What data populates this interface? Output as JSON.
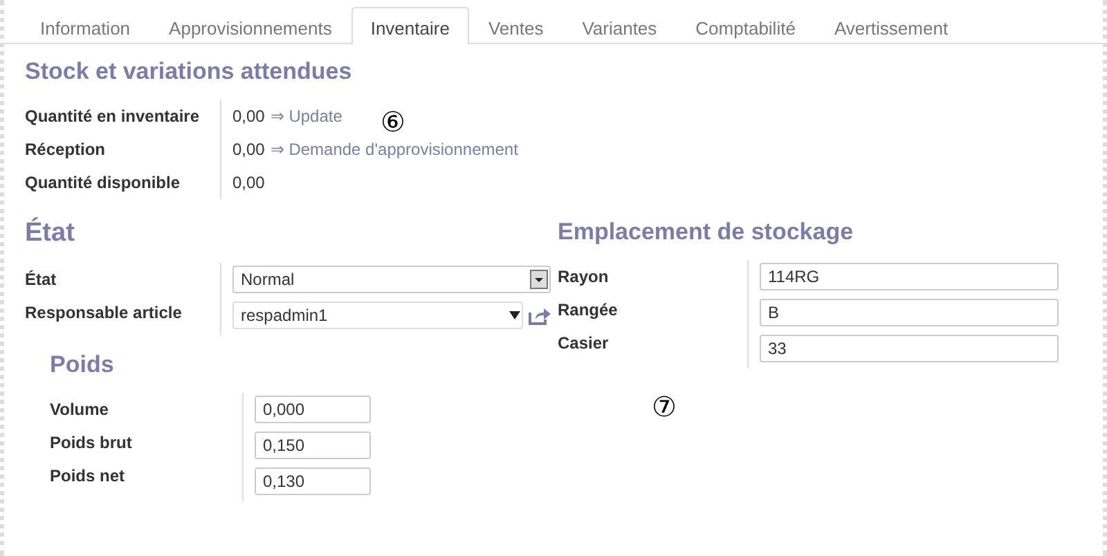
{
  "tabs": [
    {
      "label": "Information",
      "selected": false
    },
    {
      "label": "Approvisionnements",
      "selected": false
    },
    {
      "label": "Inventaire",
      "selected": true
    },
    {
      "label": "Ventes",
      "selected": false
    },
    {
      "label": "Variantes",
      "selected": false
    },
    {
      "label": "Comptabilité",
      "selected": false
    },
    {
      "label": "Avertissement",
      "selected": false
    }
  ],
  "stock": {
    "title": "Stock et variations attendues",
    "rows": [
      {
        "label": "Quantité en inventaire",
        "value": "0,00",
        "link": "⇒ Update"
      },
      {
        "label": "Réception",
        "value": "0,00",
        "link": "⇒ Demande d'approvisionnement"
      },
      {
        "label": "Quantité disponible",
        "value": "0,00"
      }
    ]
  },
  "etat": {
    "title": "État",
    "rows": [
      {
        "label": "État",
        "kind": "select",
        "value": "Normal"
      },
      {
        "label": "Responsable article",
        "kind": "many2one",
        "value": "respadmin1"
      }
    ]
  },
  "emplacement": {
    "title": "Emplacement de stockage",
    "rows": [
      {
        "label": "Rayon",
        "value": "114RG"
      },
      {
        "label": "Rangée",
        "value": "B"
      },
      {
        "label": "Casier",
        "value": "33"
      }
    ]
  },
  "poids": {
    "title": "Poids",
    "rows": [
      {
        "label": "Volume",
        "value": "0,000"
      },
      {
        "label": "Poids brut",
        "value": "0,150"
      },
      {
        "label": "Poids net",
        "value": "0,130"
      }
    ]
  },
  "callouts": [
    "⑥",
    "⑦"
  ]
}
